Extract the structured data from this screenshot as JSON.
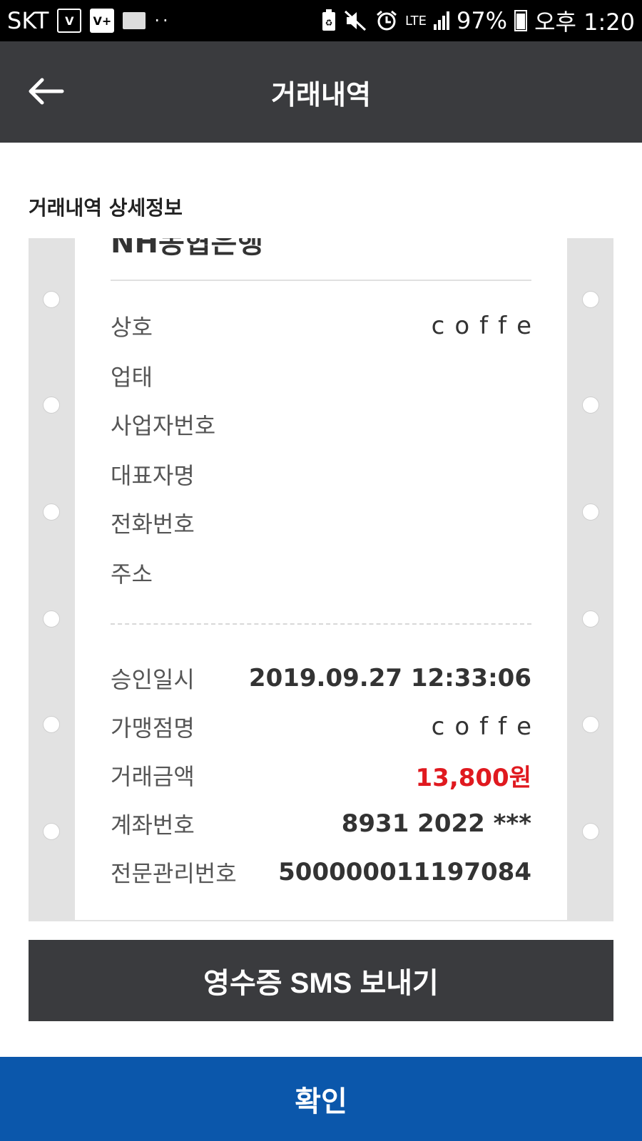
{
  "status_bar": {
    "carrier": "SKT",
    "network": "LTE",
    "battery_percent": "97%",
    "time": "오후 1:20",
    "icons": [
      "volte-icon",
      "volte-plus-icon",
      "folder-icon",
      "more-dots-icon",
      "battery-saver-icon",
      "mute-icon",
      "alarm-icon",
      "signal-icon",
      "battery-icon"
    ]
  },
  "app_bar": {
    "title": "거래내역",
    "back_icon": "arrow-left-icon"
  },
  "section_title": "거래내역 상세정보",
  "receipt": {
    "cut_off_header": "NH농협은행",
    "merchant_info": [
      {
        "label": "상호",
        "value": "coffe"
      },
      {
        "label": "업태",
        "value": ""
      },
      {
        "label": "사업자번호",
        "value": ""
      },
      {
        "label": "대표자명",
        "value": ""
      },
      {
        "label": "전화번호",
        "value": ""
      },
      {
        "label": "주소",
        "value": ""
      }
    ],
    "transaction_info": [
      {
        "label": "승인일시",
        "value": "2019.09.27 12:33:06"
      },
      {
        "label": "가맹점명",
        "value": "coffe"
      },
      {
        "label": "거래금액",
        "value": "13,800원"
      },
      {
        "label": "계좌번호",
        "value": "8931 2022 ***"
      },
      {
        "label": "전문관리번호",
        "value": "500000011197084"
      }
    ]
  },
  "colors": {
    "app_bar": "#3a3b3e",
    "confirm": "#0b57ab",
    "amount": "#e0191f",
    "frame": "#e2e2e2"
  },
  "buttons": {
    "sms": "영수증 SMS 보내기",
    "confirm": "확인"
  }
}
